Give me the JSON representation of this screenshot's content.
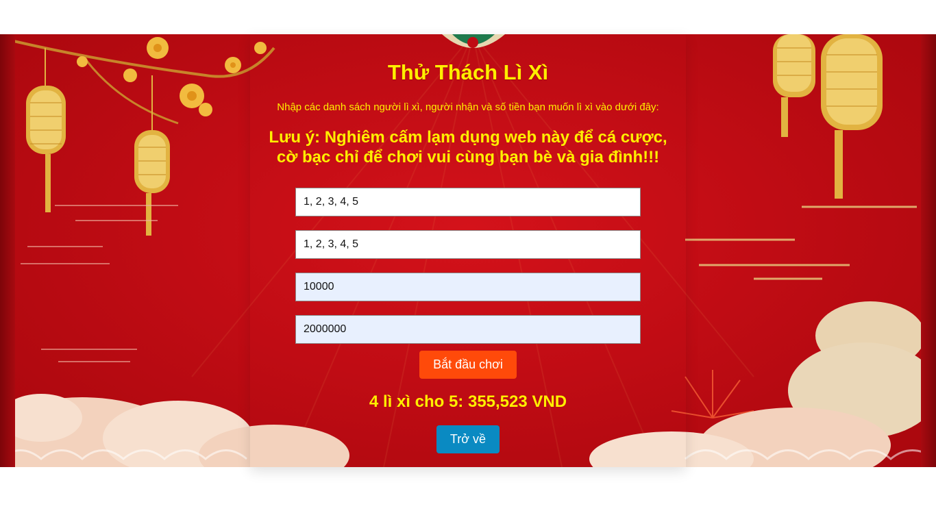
{
  "page": {
    "title": "Thử Thách Lì Xì",
    "subtitle": "Nhập các danh sách người lì xì, người nhận và số tiền bạn muốn lì xì vào dưới đây:",
    "warning": "Lưu ý: Nghiêm cấm lạm dụng web này để cá cược, cờ bạc chỉ để chơi vui cùng bạn bè và gia đình!!!"
  },
  "form": {
    "givers_value": "1, 2, 3, 4, 5",
    "receivers_value": "1, 2, 3, 4, 5",
    "min_amount_value": "10000",
    "max_amount_value": "2000000",
    "start_label": "Bắt đầu chơi"
  },
  "result": {
    "text": "4 lì xì cho 5: 355,523 VND"
  },
  "nav": {
    "back_label": "Trở về"
  },
  "colors": {
    "background_red": "#c00c14",
    "text_yellow": "#ffef00",
    "start_button": "#ff4a0a",
    "back_button": "#0a8ac2"
  },
  "icons": {
    "lantern": "lantern-icon",
    "cloud": "cloud-icon",
    "flower": "flower-icon"
  }
}
